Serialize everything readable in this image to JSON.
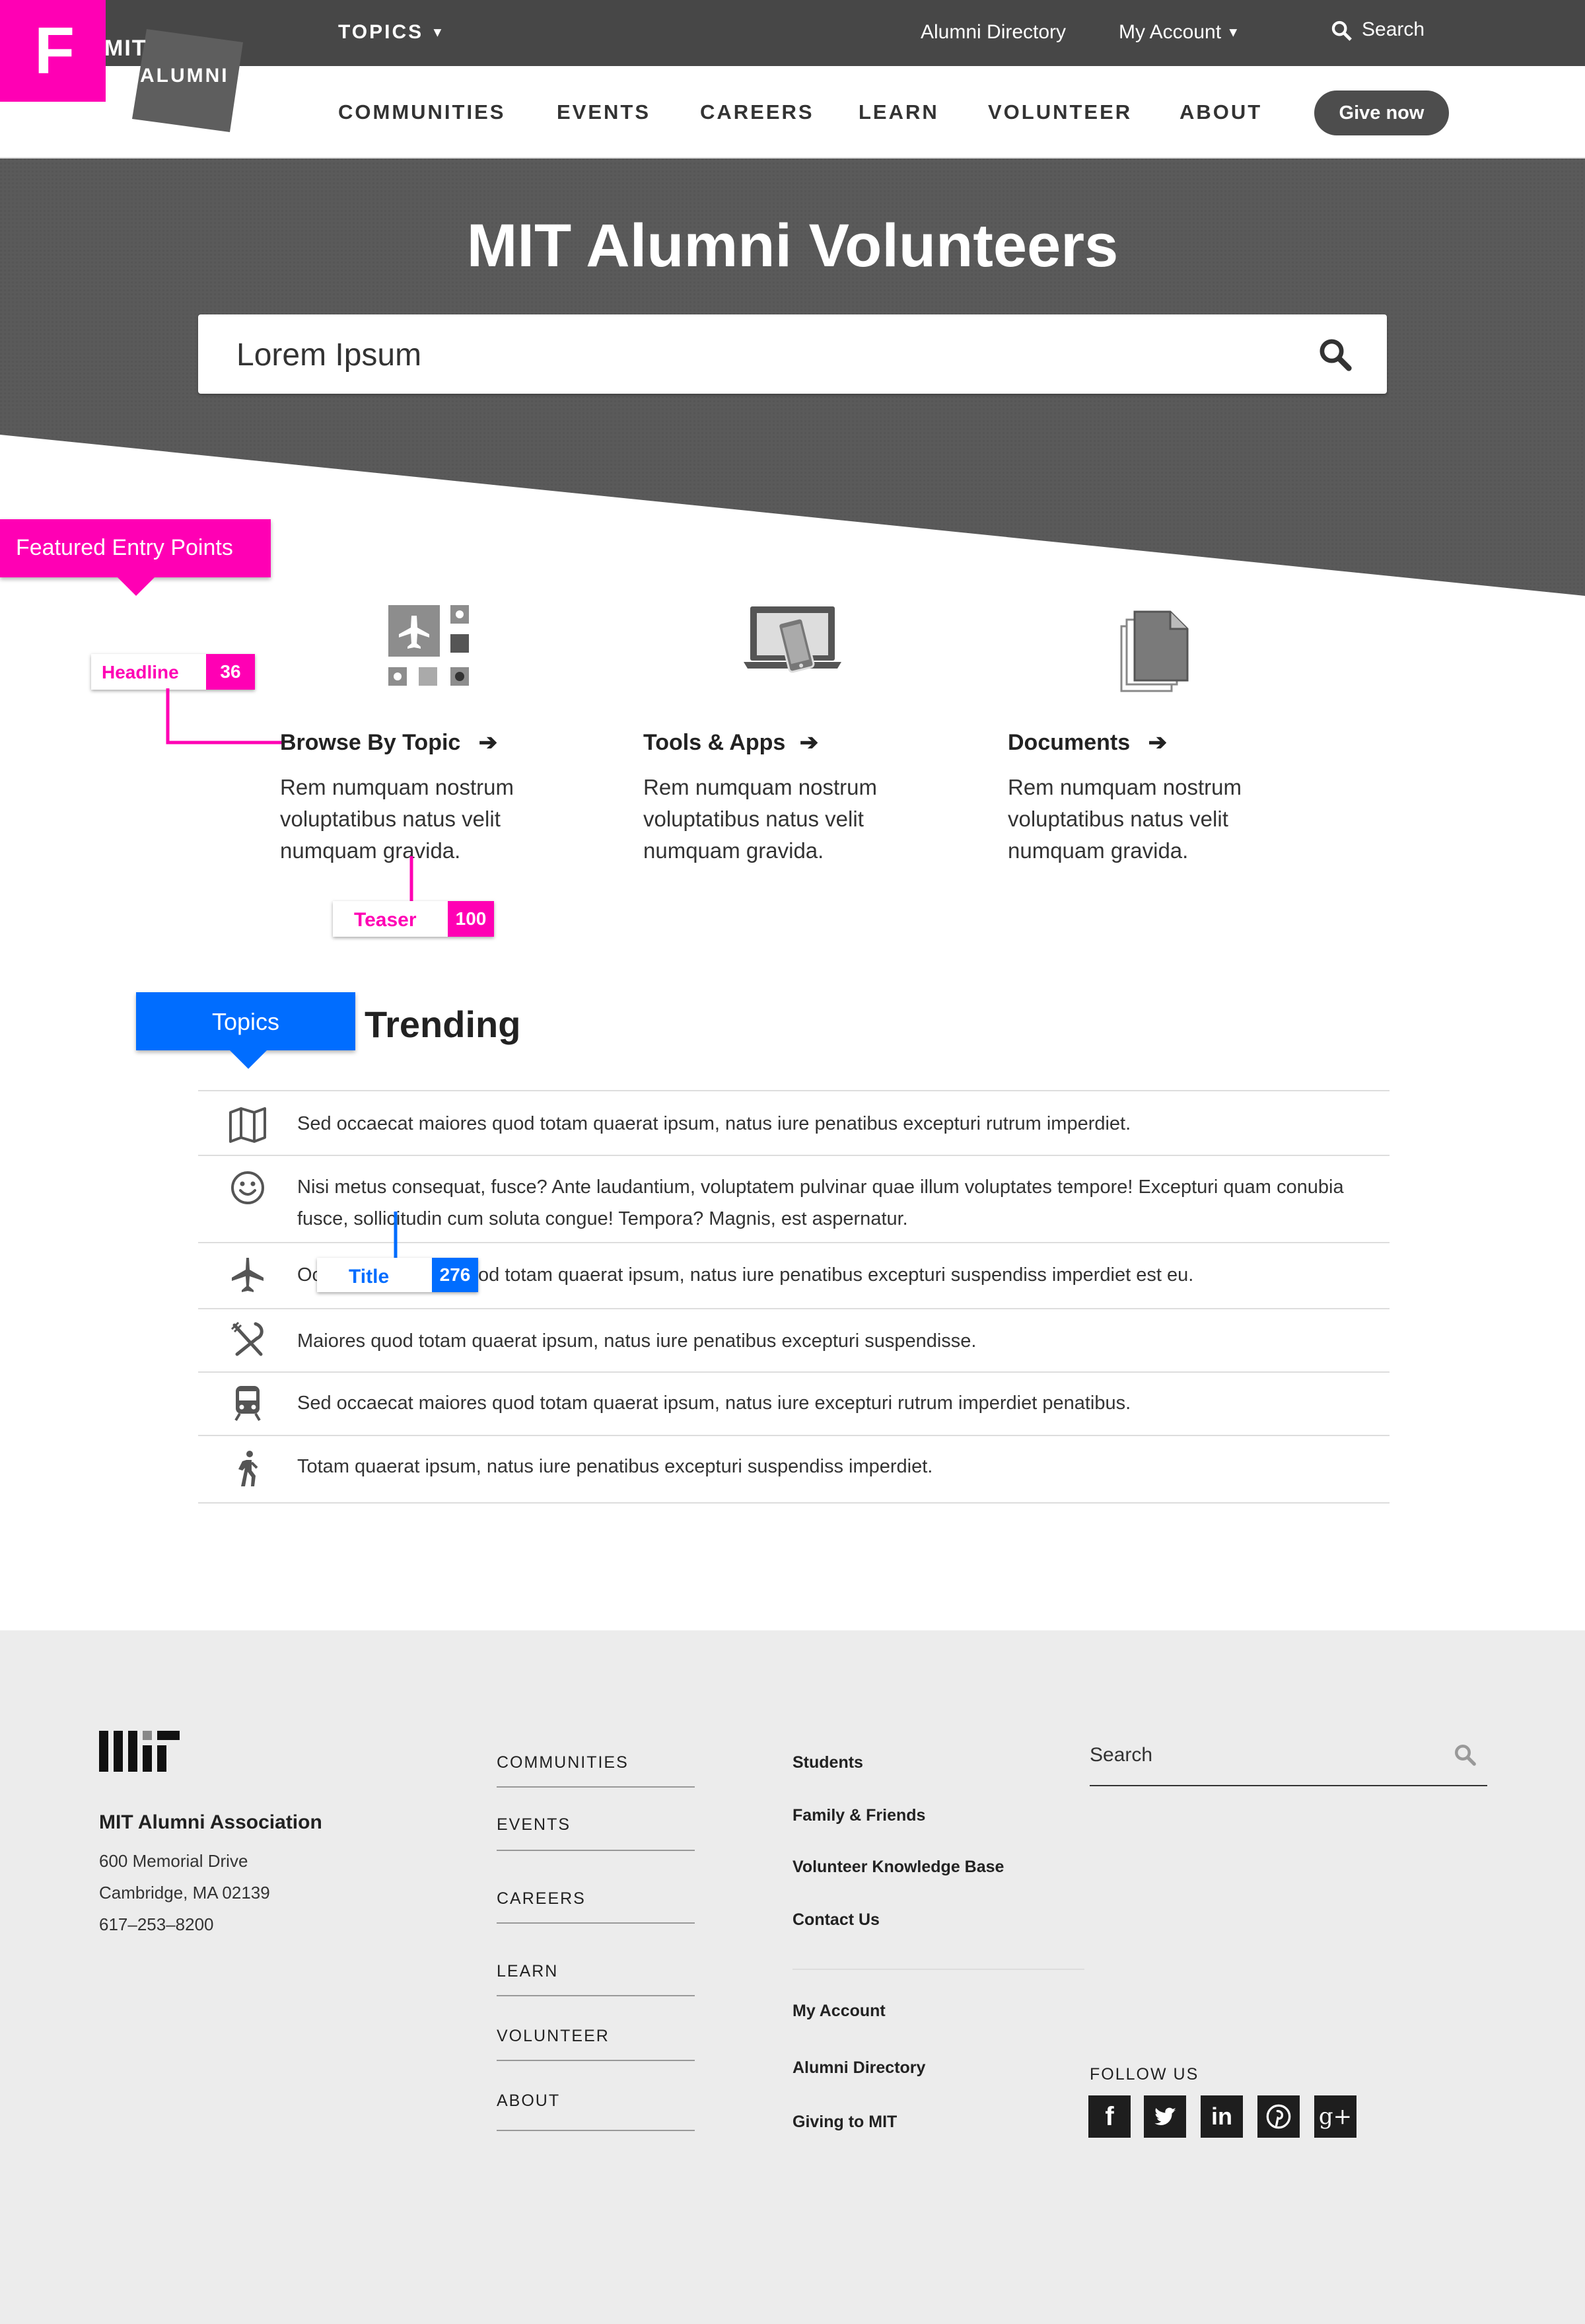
{
  "badge": {
    "letter": "F"
  },
  "logo": {
    "line1": "MIT",
    "line2": "ALUMNI"
  },
  "topbar": {
    "topics_label": "TOPICS",
    "alumni_directory": "Alumni Directory",
    "my_account": "My Account",
    "search": "Search"
  },
  "nav": {
    "items": [
      "COMMUNITIES",
      "EVENTS",
      "CAREERS",
      "LEARN",
      "VOLUNTEER",
      "ABOUT"
    ],
    "give_now": "Give now"
  },
  "hero": {
    "title": "MIT Alumni Volunteers",
    "search_value": "Lorem Ipsum"
  },
  "annotations": {
    "featured": "Featured Entry Points",
    "headline_label": "Headline",
    "headline_count": "36",
    "teaser_label": "Teaser",
    "teaser_count": "100",
    "topics": "Topics",
    "title_label": "Title",
    "title_count": "276"
  },
  "features": [
    {
      "icon": "topic-grid-icon",
      "title": "Browse By Topic",
      "teaser": "Rem numquam nostrum voluptatibus natus velit numquam gravida."
    },
    {
      "icon": "devices-icon",
      "title": "Tools & Apps",
      "teaser": "Rem numquam nostrum voluptatibus natus velit numquam gravida."
    },
    {
      "icon": "documents-icon",
      "title": "Documents",
      "teaser": "Rem numquam nostrum voluptatibus natus velit numquam gravida."
    }
  ],
  "trending": {
    "heading": "Trending",
    "items": [
      {
        "icon": "map-icon",
        "text": "Sed occaecat maiores quod totam quaerat ipsum, natus iure penatibus excepturi  rutrum imperdiet."
      },
      {
        "icon": "smiley-icon",
        "text": "Nisi metus consequat, fusce? Ante laudantium, voluptatem pulvinar quae illum voluptates tempore! Excepturi quam conubia fusce, sollicitudin cum soluta congue! Tempora? Magnis, est aspernatur."
      },
      {
        "icon": "plane-icon",
        "text": "Occaecat maiores quod totam quaerat ipsum, natus iure penatibus excepturi suspendiss imperdiet est eu."
      },
      {
        "icon": "utensils-icon",
        "text": "Maiores quod totam quaerat ipsum, natus iure penatibus excepturi suspendisse."
      },
      {
        "icon": "train-icon",
        "text": "Sed occaecat maiores quod totam quaerat ipsum, natus iure excepturi rutrum imperdiet penatibus."
      },
      {
        "icon": "walking-icon",
        "text": "Totam quaerat ipsum, natus iure penatibus excepturi suspendiss imperdiet."
      }
    ]
  },
  "footer": {
    "org": "MIT Alumni Association",
    "address1": "600 Memorial Drive",
    "address2": "Cambridge, MA 02139",
    "phone": "617–253–8200",
    "col1": [
      "COMMUNITIES",
      "EVENTS",
      "CAREERS",
      "LEARN",
      "VOLUNTEER",
      "ABOUT"
    ],
    "col2a": [
      "Students",
      "Family & Friends",
      "Volunteer Knowledge Base",
      "Contact Us"
    ],
    "col2b": [
      "My Account",
      "Alumni Directory",
      "Giving to MIT"
    ],
    "search_placeholder": "Search",
    "follow_us": "FOLLOW US",
    "social": [
      "facebook-icon",
      "twitter-icon",
      "linkedin-icon",
      "pinterest-icon",
      "google-plus-icon"
    ]
  },
  "colors": {
    "accent_pink": "#ff00b4",
    "accent_blue": "#006dff",
    "hero_gray": "#5a5a5a",
    "topbar": "#474747"
  }
}
